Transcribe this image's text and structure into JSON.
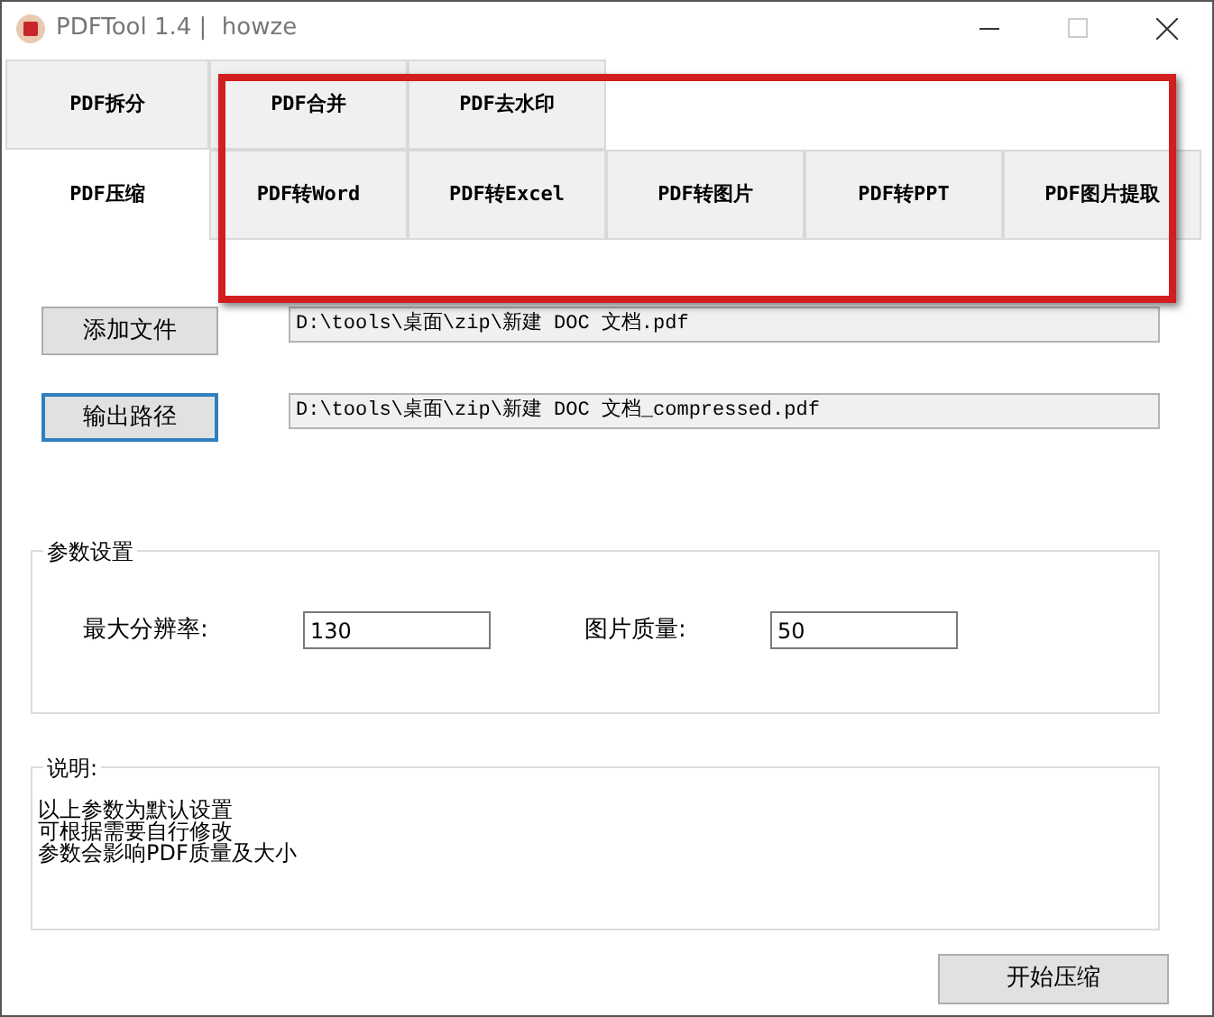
{
  "window": {
    "title": "PDFTool 1.4 |  howze"
  },
  "tab_rows": [
    [
      {
        "label": "PDF拆分",
        "selected": false
      },
      {
        "label": "PDF合并",
        "selected": false
      },
      {
        "label": "PDF去水印",
        "selected": false
      }
    ],
    [
      {
        "label": "PDF压缩",
        "selected": true
      },
      {
        "label": "PDF转Word",
        "selected": false
      },
      {
        "label": "PDF转Excel",
        "selected": false
      },
      {
        "label": "PDF转图片",
        "selected": false
      },
      {
        "label": "PDF转PPT",
        "selected": false
      },
      {
        "label": "PDF图片提取",
        "selected": false
      }
    ]
  ],
  "files": [
    {
      "button": "添加文件",
      "focused": false,
      "path": "D:\\tools\\桌面\\zip\\新建 DOC 文档.pdf"
    },
    {
      "button": "输出路径",
      "focused": true,
      "path": "D:\\tools\\桌面\\zip\\新建 DOC 文档_compressed.pdf"
    }
  ],
  "params": {
    "title": "参数设置",
    "fields": [
      {
        "label": "最大分辨率:",
        "value": "130"
      },
      {
        "label": "图片质量:",
        "value": "50"
      }
    ]
  },
  "notes": {
    "title": "说明:",
    "lines": [
      "以上参数为默认设置",
      "可根据需要自行修改",
      "参数会影响PDF质量及大小"
    ]
  },
  "start_button": "开始压缩"
}
